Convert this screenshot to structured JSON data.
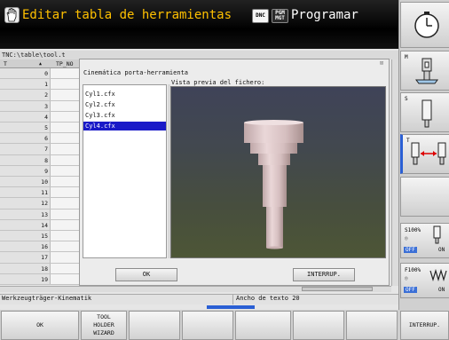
{
  "header": {
    "mode_title": "Editar tabla de herramientas",
    "dnc_badge": "DNC",
    "pgm_badge_line1": "PGM",
    "pgm_badge_line2": "MGT",
    "program_title": "Programar",
    "hand_icon": "hand-icon"
  },
  "path": "TNC:\\table\\tool.t",
  "table": {
    "columns": [
      "T",
      "TP_NO"
    ],
    "rows": [
      "0",
      "1",
      "2",
      "3",
      "4",
      "5",
      "6",
      "7",
      "8",
      "9",
      "10",
      "11",
      "12",
      "13",
      "14",
      "15",
      "16",
      "17",
      "18",
      "19"
    ]
  },
  "dialog": {
    "title": "Cinemática porta-herramienta",
    "close_glyph": "⊠",
    "preview_label": "Vista previa del fichero:",
    "files": [
      "Cyl1.cfx",
      "Cyl2.cfx",
      "Cyl3.cfx",
      "Cyl4.cfx"
    ],
    "selected_file": "Cyl4.cfx",
    "ok_label": "OK",
    "cancel_label": "INTERRUP."
  },
  "status": {
    "left": "Werkzeugträger-Kinematik",
    "right": "Ancho de texto 20"
  },
  "softkeys": {
    "ok": "OK",
    "tool_holder_1": "TOOL",
    "tool_holder_2": "HOLDER",
    "tool_holder_3": "WIZARD",
    "cancel": "INTERRUP."
  },
  "side_panel": {
    "m_label": "M",
    "s_label": "S",
    "t_label": "T",
    "s_override": "S100%",
    "f_override": "F100%",
    "off1": "OFF",
    "on1": "ON",
    "off2": "OFF",
    "on2": "ON"
  },
  "colors": {
    "accent_title": "#ffc000",
    "selection": "#1a1ac8",
    "status_marker": "#2a5fd4"
  }
}
